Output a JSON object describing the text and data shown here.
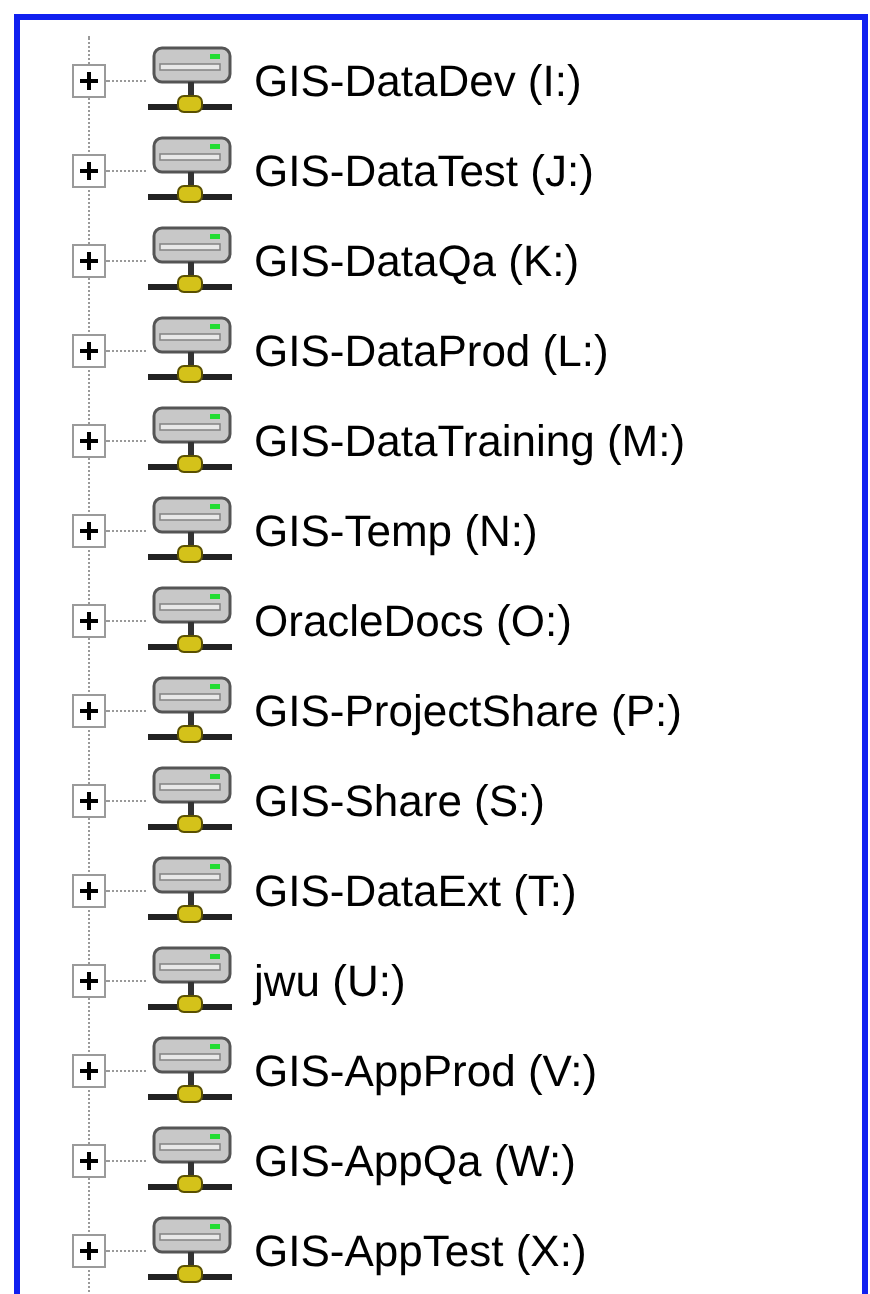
{
  "tree": {
    "items": [
      {
        "label": "GIS-DataDev (I:)",
        "expanded": false
      },
      {
        "label": "GIS-DataTest (J:)",
        "expanded": false
      },
      {
        "label": "GIS-DataQa (K:)",
        "expanded": false
      },
      {
        "label": "GIS-DataProd (L:)",
        "expanded": false
      },
      {
        "label": "GIS-DataTraining (M:)",
        "expanded": false
      },
      {
        "label": "GIS-Temp (N:)",
        "expanded": false
      },
      {
        "label": "OracleDocs (O:)",
        "expanded": false
      },
      {
        "label": "GIS-ProjectShare (P:)",
        "expanded": false
      },
      {
        "label": "GIS-Share (S:)",
        "expanded": false
      },
      {
        "label": "GIS-DataExt (T:)",
        "expanded": false
      },
      {
        "label": "jwu (U:)",
        "expanded": false
      },
      {
        "label": "GIS-AppProd (V:)",
        "expanded": false
      },
      {
        "label": "GIS-AppQa (W:)",
        "expanded": false
      },
      {
        "label": "GIS-AppTest (X:)",
        "expanded": false
      }
    ]
  }
}
